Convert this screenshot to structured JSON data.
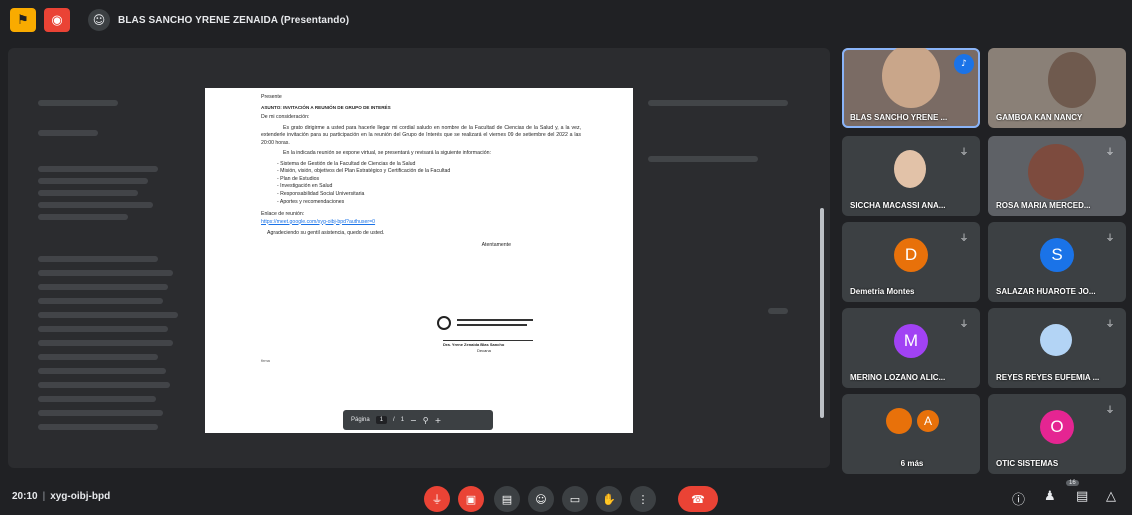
{
  "topbar": {
    "presenter_title": "BLAS SANCHO YRENE ZENAIDA (Presentando)"
  },
  "document": {
    "greeting": "Presente",
    "subject": "ASUNTO: INVITACIÓN A REUNIÓN DE GRUPO DE INTERÉS",
    "salutation": "De mi consideración:",
    "para1": "Es grato dirigirme a usted para hacerle llegar mi cordial saludo en nombre de la Facultad de Ciencias de la Salud y, a la vez, extenderle invitación para su participación en la reunión del Grupo de Interés que se realizará el viernes 09 de setiembre del 2022 a las 20:00 horas.",
    "para2": "En la indicada reunión se expone virtual, se presentará y revisará la siguiente información:",
    "items": [
      "Sistema de Gestión de la Facultad de Ciencias de la Salud",
      "Misión, visión, objetivos del Plan Estratégico y Certificación de la Facultad",
      "Plan de Estudios",
      "Investigación en Salud",
      "Responsabilidad Social Universitaria",
      "Aportes y recomendaciones"
    ],
    "link_label": "Enlace de reunión:",
    "link_url": "https://meet.google.com/xyg-oibj-bpd?authuser=0",
    "thanks": "Agradeciendo su gentil asistencia, quedo de usted.",
    "closing": "Atentamente",
    "signature_name": "Dra. Yrene Zenaida Blas Sancho",
    "signature_role": "Decana",
    "footer_mark": "firma"
  },
  "viewer": {
    "page_label": "Página",
    "page_value": "1",
    "page_sep": "/",
    "page_total": "1"
  },
  "participants": [
    {
      "name": "BLAS SANCHO YRENE ...",
      "speaking": true
    },
    {
      "name": "GAMBOA KAN NANCY",
      "speaking": false
    },
    {
      "name": "SICCHA MACASSI ANA...",
      "speaking": false
    },
    {
      "name": "ROSA MARIA MERCED...",
      "speaking": false
    },
    {
      "name": "Demetria Montes",
      "initial": "D",
      "color": "#e8710a"
    },
    {
      "name": "SALAZAR HUAROTE JO...",
      "initial": "S",
      "color": "#1a73e8"
    },
    {
      "name": "MERINO LOZANO ALIC...",
      "initial": "M",
      "color": "#a142f4"
    },
    {
      "name": "REYES REYES EUFEMIA ...",
      "speaking": false
    },
    {
      "name": "6 más",
      "initial": "A",
      "color": "#e8710a"
    },
    {
      "name": "OTIC SISTEMAS",
      "initial": "O",
      "color": "#e52592"
    }
  ],
  "bottombar": {
    "time": "20:10",
    "separator": "|",
    "meeting_code": "xyg-oibj-bpd",
    "people_count": "16"
  },
  "colors": {
    "background": "#202124",
    "tile": "#3c4043",
    "danger": "#ea4335",
    "accent": "#1a73e8"
  }
}
